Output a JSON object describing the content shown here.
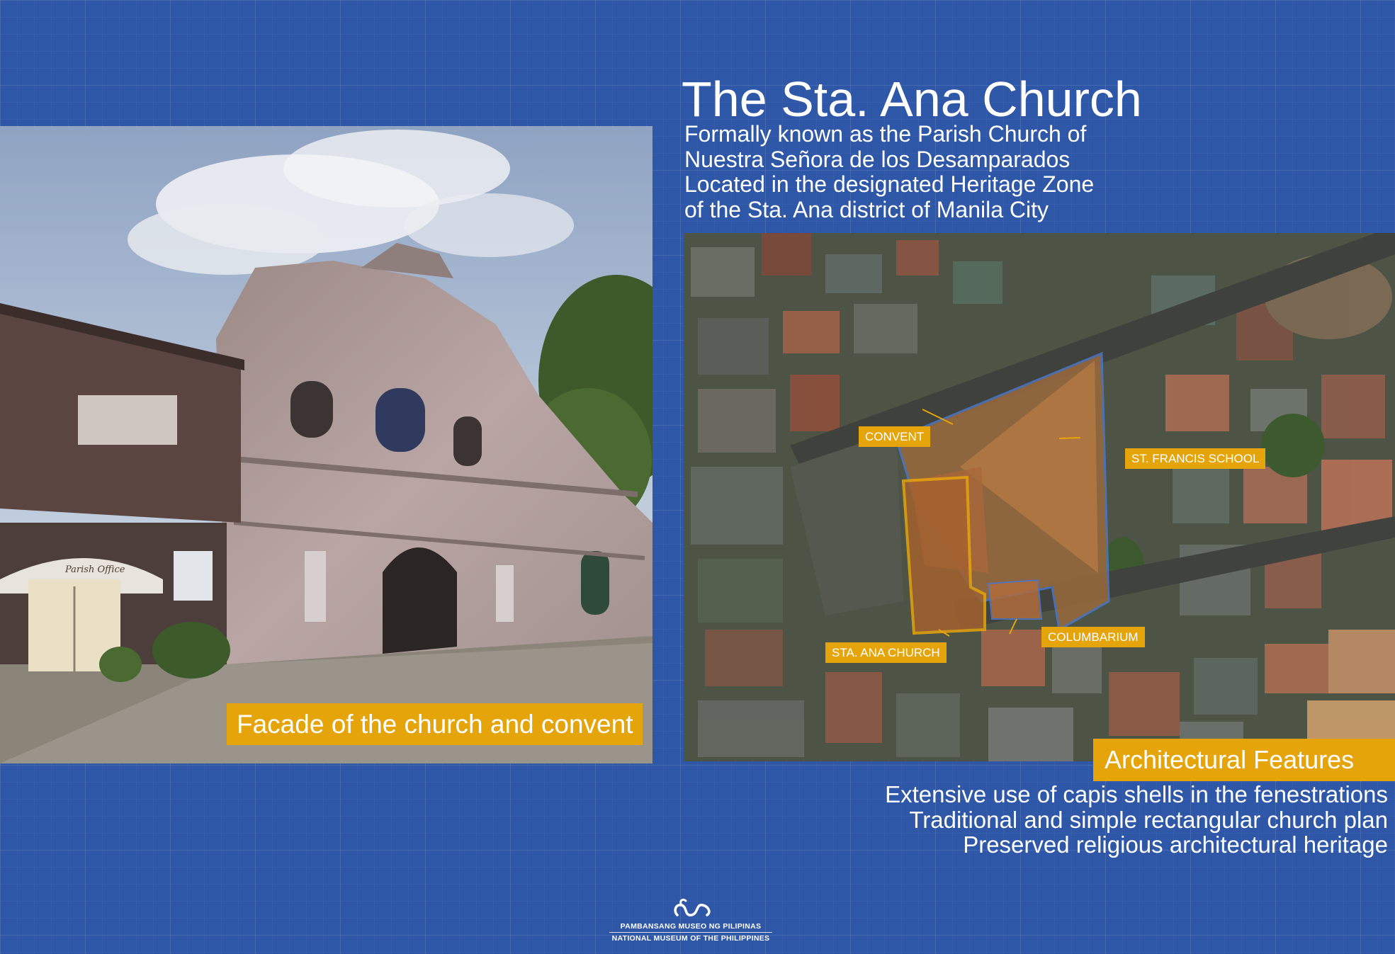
{
  "header": {
    "title": "The Sta. Ana Church",
    "subtitle_lines": [
      "Formally known as the Parish Church of",
      "Nuestra Señora de los Desamparados",
      "Located in the designated Heritage Zone",
      "of the Sta. Ana district of Manila City"
    ]
  },
  "photo": {
    "caption": "Facade of the church and convent",
    "sign_text": "Parish Office"
  },
  "map": {
    "labels": {
      "convent": "CONVENT",
      "st_francis": "ST. FRANCIS SCHOOL",
      "columbarium": "COLUMBARIUM",
      "sta_ana": "STA. ANA CHURCH"
    }
  },
  "features": {
    "heading": "Architectural Features",
    "items": [
      "Extensive use of capis shells in the fenestrations",
      "Traditional and simple rectangular church plan",
      "Preserved religious architectural heritage"
    ]
  },
  "footer": {
    "line1": "PAMBANSANG MUSEO NG PILIPINAS",
    "line2": "NATIONAL MUSEUM OF THE PHILIPPINES"
  },
  "colors": {
    "background": "#2f57a8",
    "accent": "#e6a40b",
    "text": "#ffffff"
  }
}
